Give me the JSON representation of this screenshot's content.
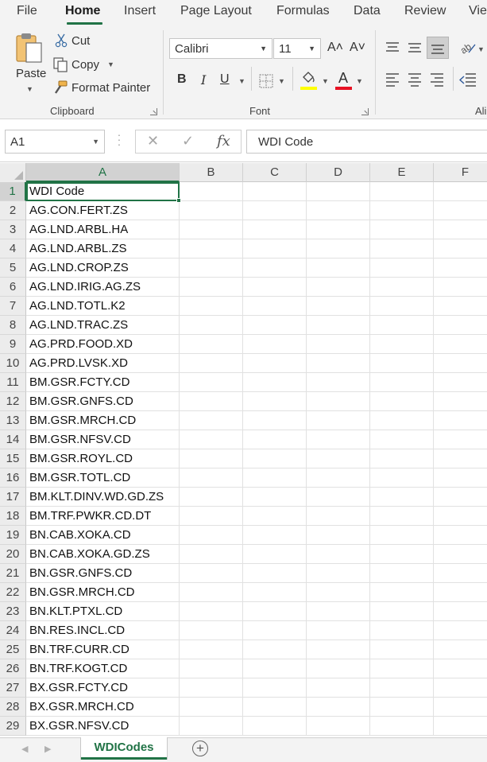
{
  "ribbon": {
    "tabs": [
      "File",
      "Home",
      "Insert",
      "Page Layout",
      "Formulas",
      "Data",
      "Review",
      "Vie"
    ],
    "active_tab": "Home",
    "clipboard": {
      "paste_label": "Paste",
      "cut_label": "Cut",
      "copy_label": "Copy",
      "format_painter_label": "Format Painter",
      "group_label": "Clipboard"
    },
    "font": {
      "font_name": "Calibri",
      "font_size": "11",
      "group_label": "Font",
      "grow_glyph": "A˄",
      "shrink_glyph": "A˅",
      "bold": "B",
      "italic": "I",
      "underline": "U",
      "font_color_glyph": "A",
      "font_color": "#e81123",
      "highlight_color": "#ffff00"
    },
    "alignment": {
      "group_label": "Ali"
    }
  },
  "formula_bar": {
    "name_box": "A1",
    "cancel_glyph": "✕",
    "enter_glyph": "✓",
    "fx_glyph": "fx",
    "content": "WDI Code"
  },
  "grid": {
    "columns": [
      "A",
      "B",
      "C",
      "D",
      "E",
      "F"
    ],
    "selected_column": "A",
    "selected_row": "1",
    "rows": [
      {
        "num": "1",
        "a": "WDI Code"
      },
      {
        "num": "2",
        "a": "AG.CON.FERT.ZS"
      },
      {
        "num": "3",
        "a": "AG.LND.ARBL.HA"
      },
      {
        "num": "4",
        "a": "AG.LND.ARBL.ZS"
      },
      {
        "num": "5",
        "a": "AG.LND.CROP.ZS"
      },
      {
        "num": "6",
        "a": "AG.LND.IRIG.AG.ZS"
      },
      {
        "num": "7",
        "a": "AG.LND.TOTL.K2"
      },
      {
        "num": "8",
        "a": "AG.LND.TRAC.ZS"
      },
      {
        "num": "9",
        "a": "AG.PRD.FOOD.XD"
      },
      {
        "num": "10",
        "a": "AG.PRD.LVSK.XD"
      },
      {
        "num": "11",
        "a": "BM.GSR.FCTY.CD"
      },
      {
        "num": "12",
        "a": "BM.GSR.GNFS.CD"
      },
      {
        "num": "13",
        "a": "BM.GSR.MRCH.CD"
      },
      {
        "num": "14",
        "a": "BM.GSR.NFSV.CD"
      },
      {
        "num": "15",
        "a": "BM.GSR.ROYL.CD"
      },
      {
        "num": "16",
        "a": "BM.GSR.TOTL.CD"
      },
      {
        "num": "17",
        "a": "BM.KLT.DINV.WD.GD.ZS"
      },
      {
        "num": "18",
        "a": "BM.TRF.PWKR.CD.DT"
      },
      {
        "num": "19",
        "a": "BN.CAB.XOKA.CD"
      },
      {
        "num": "20",
        "a": "BN.CAB.XOKA.GD.ZS"
      },
      {
        "num": "21",
        "a": "BN.GSR.GNFS.CD"
      },
      {
        "num": "22",
        "a": "BN.GSR.MRCH.CD"
      },
      {
        "num": "23",
        "a": "BN.KLT.PTXL.CD"
      },
      {
        "num": "24",
        "a": "BN.RES.INCL.CD"
      },
      {
        "num": "25",
        "a": "BN.TRF.CURR.CD"
      },
      {
        "num": "26",
        "a": "BN.TRF.KOGT.CD"
      },
      {
        "num": "27",
        "a": "BX.GSR.FCTY.CD"
      },
      {
        "num": "28",
        "a": "BX.GSR.MRCH.CD"
      },
      {
        "num": "29",
        "a": "BX.GSR.NFSV.CD"
      }
    ]
  },
  "sheets": {
    "active": "WDICodes",
    "add_glyph": "+"
  }
}
